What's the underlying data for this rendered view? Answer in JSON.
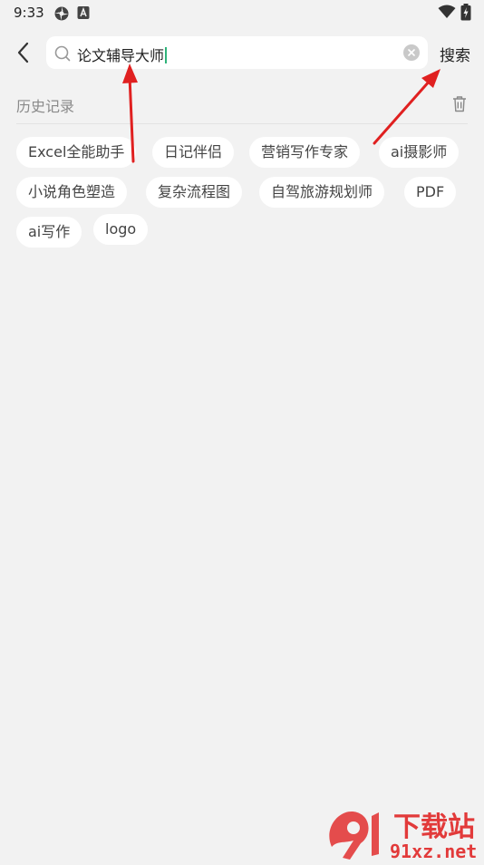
{
  "status_bar": {
    "time": "9:33",
    "icons": [
      "settings-flower-icon",
      "app-a-icon",
      "wifi-icon",
      "battery-icon"
    ]
  },
  "header": {
    "back_icon": "chevron-left-icon",
    "search": {
      "value": "论文辅导大师",
      "icon": "search-icon",
      "clear_icon": "close-circle-icon"
    },
    "search_button_label": "搜索"
  },
  "history": {
    "title": "历史记录",
    "delete_icon": "trash-icon",
    "tags": [
      "Excel全能助手",
      "日记伴侣",
      "营销写作专家",
      "ai摄影师",
      "小说角色塑造",
      "复杂流程图",
      "自驾旅游规划师",
      "PDF",
      "ai写作",
      "logo"
    ]
  },
  "annotations": {
    "arrow_color": "#e02020",
    "count": 2
  },
  "watermark": {
    "logo_text": "9f",
    "title": "下载站",
    "url": "91xz.net",
    "color": "#e23a3a"
  }
}
